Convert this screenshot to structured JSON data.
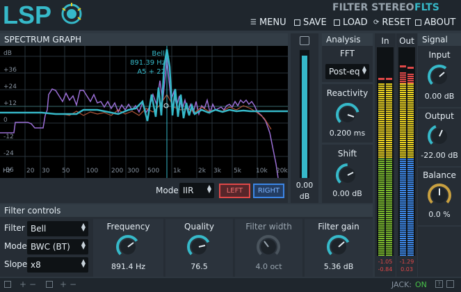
{
  "header": {
    "logo_text": "LSP",
    "plugin_name": "FILTER STEREO",
    "plugin_short": "FLTS",
    "menu": [
      {
        "label": "MENU",
        "icon": "menu-icon"
      },
      {
        "label": "SAVE",
        "icon": "save-icon"
      },
      {
        "label": "LOAD",
        "icon": "load-icon"
      },
      {
        "label": "RESET",
        "icon": "reset-icon"
      },
      {
        "label": "ABOUT",
        "icon": "about-icon"
      }
    ]
  },
  "spectrum": {
    "title": "SPECTRUM GRAPH",
    "y_labels": [
      "dB",
      "+36",
      "+24",
      "+12",
      "0",
      "-12",
      "-24",
      "-36"
    ],
    "x_labels": [
      "Hz",
      "20",
      "30",
      "50",
      "100",
      "200",
      "300",
      "500",
      "1k",
      "2k",
      "3k",
      "5k",
      "10k",
      "20k"
    ],
    "marker": {
      "type": "Bell",
      "freq": "891.39 Hz",
      "note": "A5 + 22"
    },
    "mode_label": "Mode",
    "mode_value": "IIR",
    "left_label": "LEFT",
    "right_label": "RIGHT"
  },
  "zoom": {
    "value": "0.00",
    "unit": "dB",
    "fraction": 1.0
  },
  "analysis": {
    "title": "Analysis",
    "fft_label": "FFT",
    "fft_mode": "Post-eq",
    "reactivity_label": "Reactivity",
    "reactivity_value": "0.200 ms",
    "shift_label": "Shift",
    "shift_value": "0.00 dB"
  },
  "meters": {
    "in_label": "In",
    "out_label": "Out",
    "in_values": [
      "-1.05",
      "-0.84"
    ],
    "out_values": [
      "-1.29",
      "0.03"
    ]
  },
  "signal": {
    "title": "Signal",
    "input_label": "Input",
    "input_value": "0.00 dB",
    "output_label": "Output",
    "output_value": "-22.00 dB",
    "balance_label": "Balance",
    "balance_value": "0.0 %"
  },
  "filter": {
    "title": "Filter controls",
    "filter_label": "Filter",
    "filter_value": "Bell",
    "mode_label": "Mode",
    "mode_value": "BWC (BT)",
    "slope_label": "Slope",
    "slope_value": "x8",
    "frequency_label": "Frequency",
    "frequency_value": "891.4 Hz",
    "quality_label": "Quality",
    "quality_value": "76.5",
    "width_label": "Filter width",
    "width_value": "4.0 oct",
    "gain_label": "Filter gain",
    "gain_value": "5.36 dB"
  },
  "status": {
    "jack_label": "JACK:",
    "jack_value": "ON"
  },
  "colors": {
    "accent": "#36b9c9",
    "left": "#e04848",
    "right": "#3c86e6",
    "meter_green": "#7ab82c",
    "meter_yellow": "#e8d020"
  }
}
